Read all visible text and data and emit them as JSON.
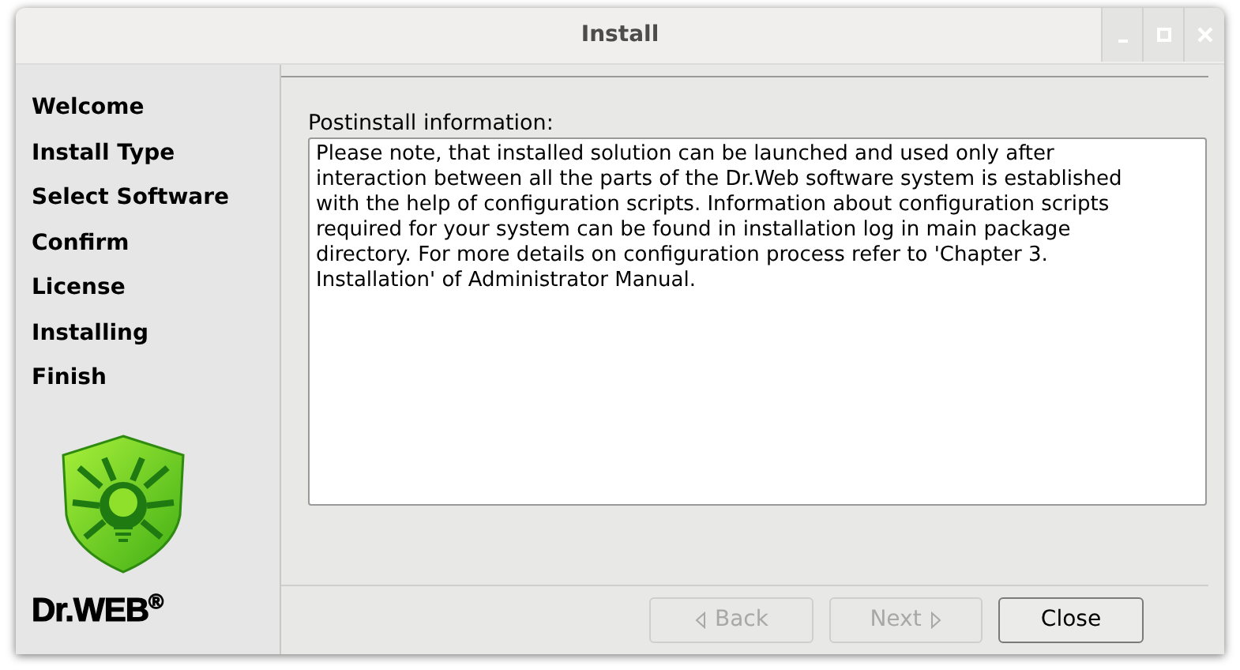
{
  "window": {
    "title": "Install"
  },
  "steps": [
    "Welcome",
    "Install Type",
    "Select Software",
    "Confirm",
    "License",
    "Installing",
    "Finish"
  ],
  "brand": {
    "text": "Dr.WEB$^{®}$"
  },
  "content": {
    "label": "Postinstall information:",
    "text": "Please note, that installed solution can be launched and used only after interaction between all the parts of the Dr.Web software system is established with the help of configuration scripts. Information about configuration scripts required for your system can be found in installation log in main package directory. For more details on configuration process refer to 'Chapter 3. Installation' of Administrator Manual."
  },
  "buttons": [
    {
      "label": "Back",
      "disabled": true,
      "kind": "back"
    },
    {
      "label": "Next",
      "disabled": true,
      "kind": "next"
    },
    {
      "label": "Close",
      "disabled": false,
      "kind": "plain"
    }
  ]
}
